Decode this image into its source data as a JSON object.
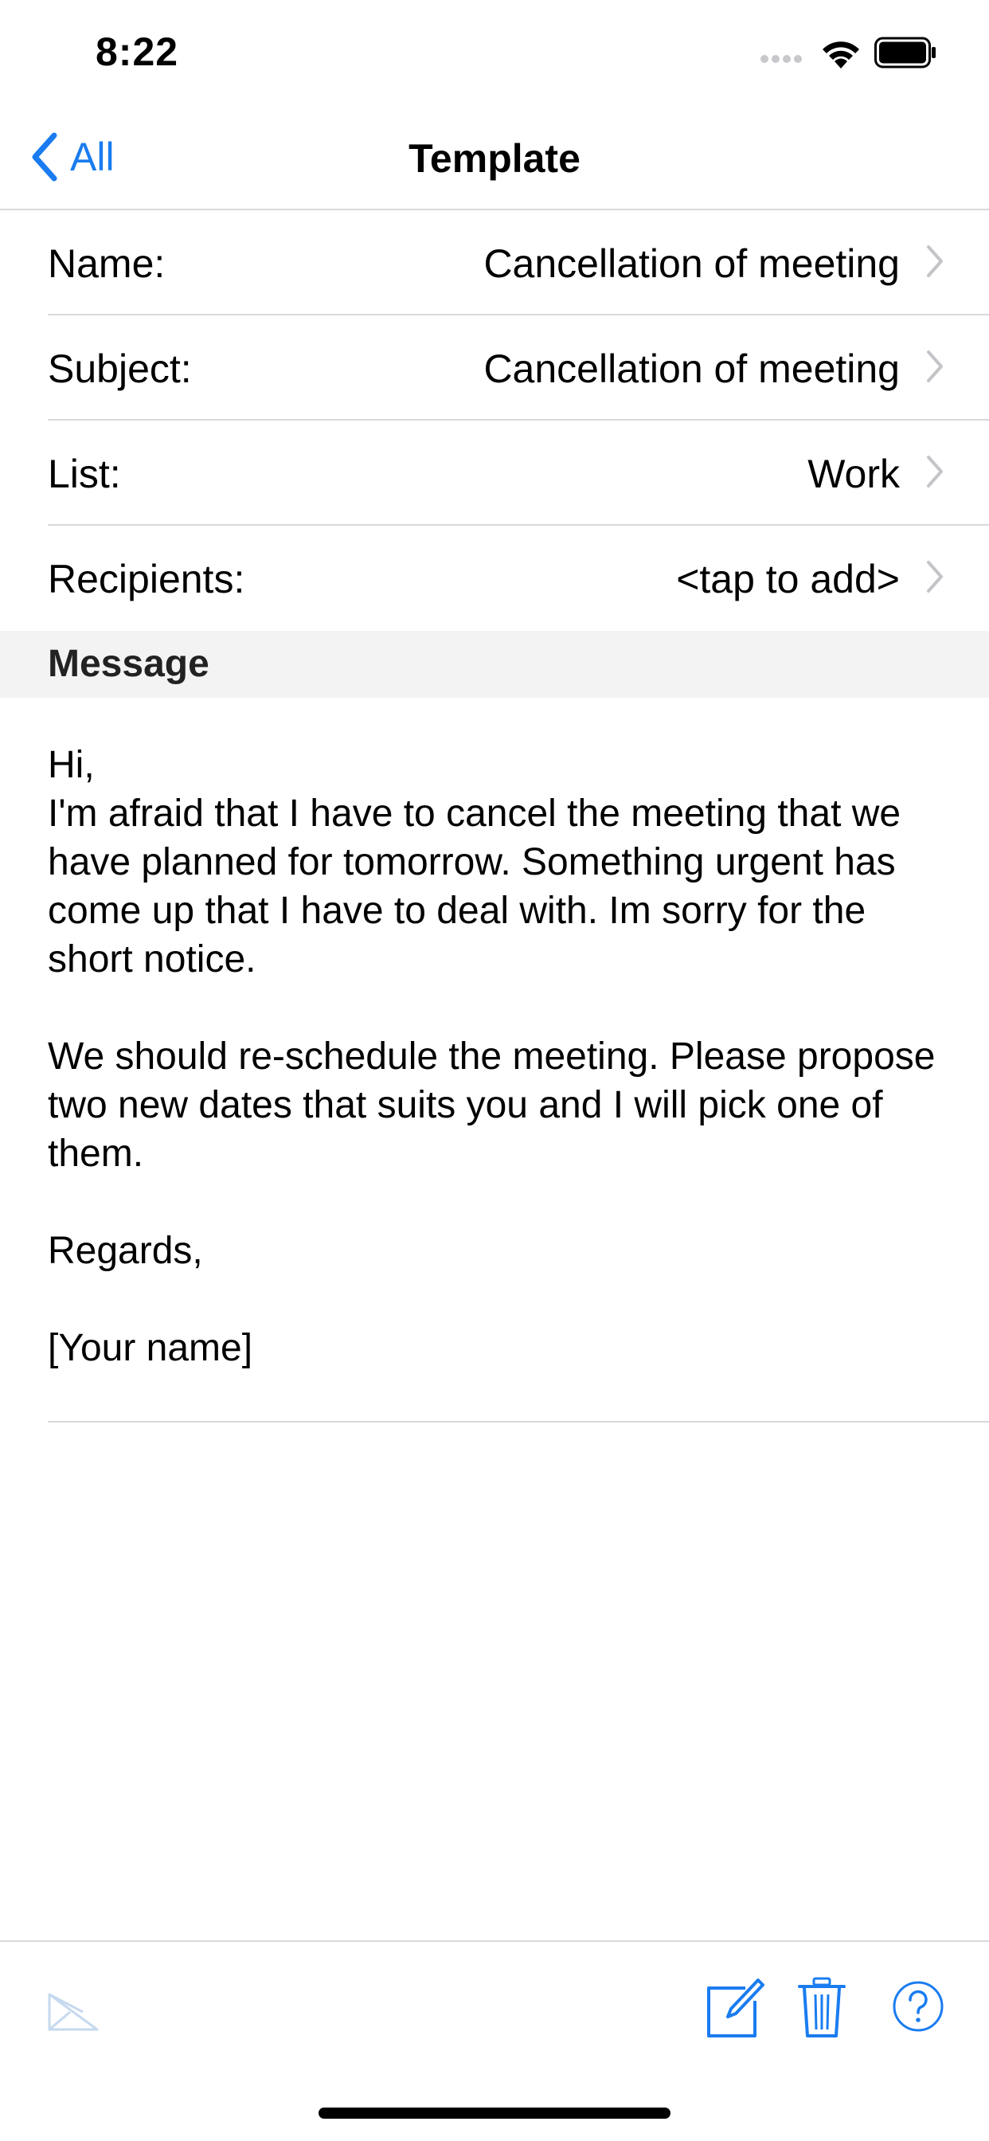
{
  "status_bar": {
    "time": "8:22"
  },
  "nav": {
    "back_label": "All",
    "title": "Template"
  },
  "fields": [
    {
      "label": "Name:",
      "value": "Cancellation of meeting"
    },
    {
      "label": "Subject:",
      "value": "Cancellation of meeting"
    },
    {
      "label": "List:",
      "value": "Work"
    },
    {
      "label": "Recipients:",
      "value": "<tap to add>"
    }
  ],
  "message": {
    "section_title": "Message",
    "greeting": "Hi,",
    "paragraph1": "I'm afraid that I have to cancel the meeting that we have planned for tomorrow. Something urgent has come up that I have to deal with. Im sorry for the short notice.",
    "paragraph2": "We should re-schedule the meeting. Please propose two new dates that suits you and I will pick one of them.",
    "closing": "Regards,",
    "signature": "[Your name]"
  },
  "toolbar": {
    "icons": [
      "send-mail-icon",
      "compose-icon",
      "trash-icon",
      "help-icon"
    ]
  },
  "colors": {
    "accent": "#1a7cf0",
    "disabled": "#c6d9ef",
    "separator": "#d8d8dc",
    "section_bg": "#f3f3f4"
  }
}
